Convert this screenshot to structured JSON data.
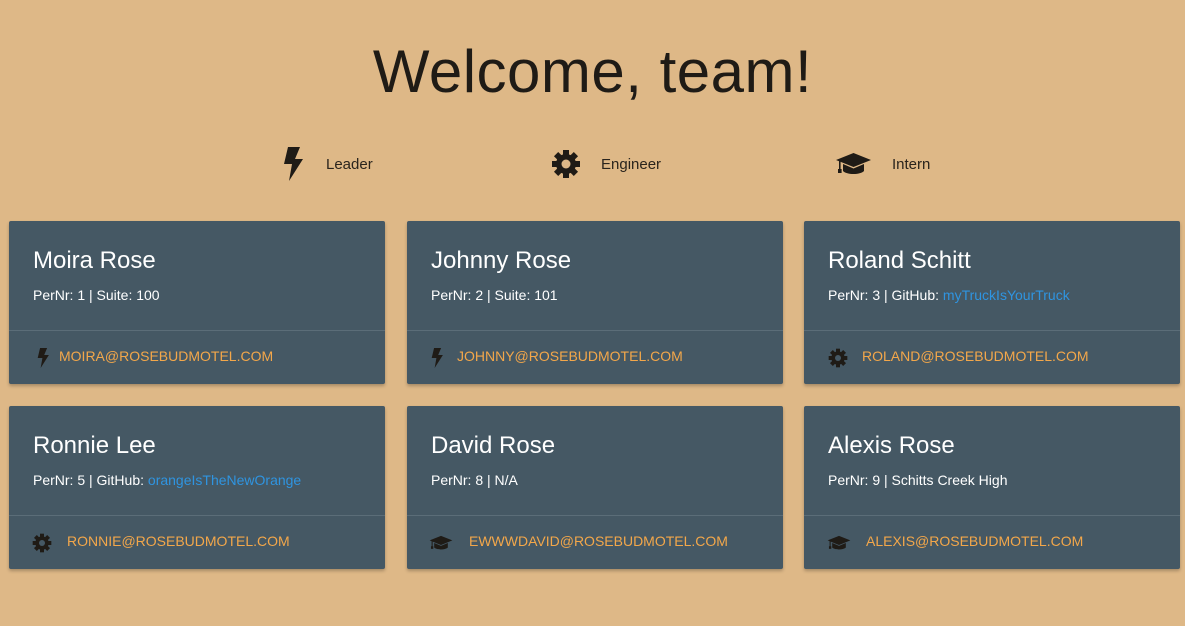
{
  "header": {
    "title": "Welcome, team!"
  },
  "legend": {
    "items": [
      {
        "label": "Leader",
        "icon": "bolt-icon"
      },
      {
        "label": "Engineer",
        "icon": "gear-icon"
      },
      {
        "label": "Intern",
        "icon": "graduation-cap-icon"
      }
    ]
  },
  "colors": {
    "background": "#deb887",
    "card": "#455864",
    "email": "#f3a74a",
    "link": "#2f94e0"
  },
  "members": [
    {
      "name": "Moira Rose",
      "pernr": "PerNr: 1",
      "detail_label": "Suite: 100",
      "link": "",
      "email": "MOIRA@ROSEBUDMOTEL.COM",
      "role_icon": "bolt-icon"
    },
    {
      "name": "Johnny Rose",
      "pernr": "PerNr: 2",
      "detail_label": "Suite: 101",
      "link": "",
      "email": "JOHNNY@ROSEBUDMOTEL.COM",
      "role_icon": "bolt-icon"
    },
    {
      "name": "Roland Schitt",
      "pernr": "PerNr: 3",
      "detail_label": "GitHub: ",
      "link": "myTruckIsYourTruck",
      "email": "ROLAND@ROSEBUDMOTEL.COM",
      "role_icon": "gear-icon"
    },
    {
      "name": "Ronnie Lee",
      "pernr": "PerNr: 5",
      "detail_label": "GitHub: ",
      "link": "orangeIsTheNewOrange",
      "email": "RONNIE@ROSEBUDMOTEL.COM",
      "role_icon": "gear-icon"
    },
    {
      "name": "David Rose",
      "pernr": "PerNr: 8",
      "detail_label": "N/A",
      "link": "",
      "email": "EWWWDAVID@ROSEBUDMOTEL.COM",
      "role_icon": "graduation-cap-icon"
    },
    {
      "name": "Alexis Rose",
      "pernr": "PerNr: 9",
      "detail_label": "Schitts Creek High",
      "link": "",
      "email": "ALEXIS@ROSEBUDMOTEL.COM",
      "role_icon": "graduation-cap-icon"
    }
  ]
}
